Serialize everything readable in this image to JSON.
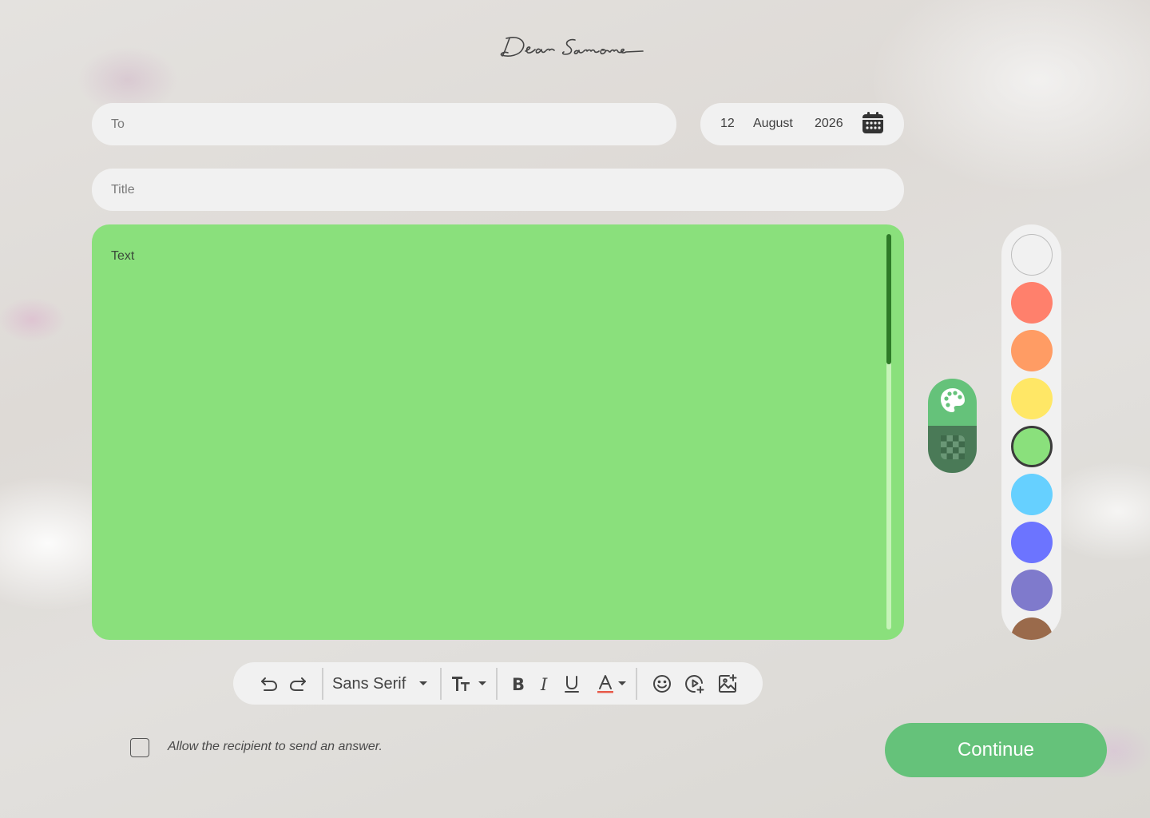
{
  "header": {
    "logo_text": "Dear Someone"
  },
  "form": {
    "to_placeholder": "To",
    "title_placeholder": "Title",
    "body_placeholder": "Text"
  },
  "date": {
    "day": "12",
    "month": "August",
    "year": "2026",
    "icon": "calendar-icon"
  },
  "style_switch": {
    "options": [
      "palette-icon",
      "pattern-icon"
    ],
    "selected": "palette-icon"
  },
  "palette": {
    "colors": [
      "#f1f1f1",
      "#ff806c",
      "#ff9c64",
      "#ffe766",
      "#8ae07c",
      "#66d0ff",
      "#6c74ff",
      "#7f7acc",
      "#9a6a4b"
    ],
    "selected": "#8ae07c"
  },
  "toolbar": {
    "undo_icon": "undo-icon",
    "redo_icon": "redo-icon",
    "font_family": "Sans Serif",
    "font_size_icon": "text-size-icon",
    "bold_icon": "bold-icon",
    "italic_icon": "italic-icon",
    "underline_icon": "underline-icon",
    "text_color_icon": "text-color-icon",
    "emoji_icon": "emoji-icon",
    "video_icon": "add-video-icon",
    "image_icon": "add-image-icon"
  },
  "footer": {
    "allow_answer_label": "Allow the recipient to send an answer.",
    "allow_answer_checked": false,
    "continue_label": "Continue"
  }
}
